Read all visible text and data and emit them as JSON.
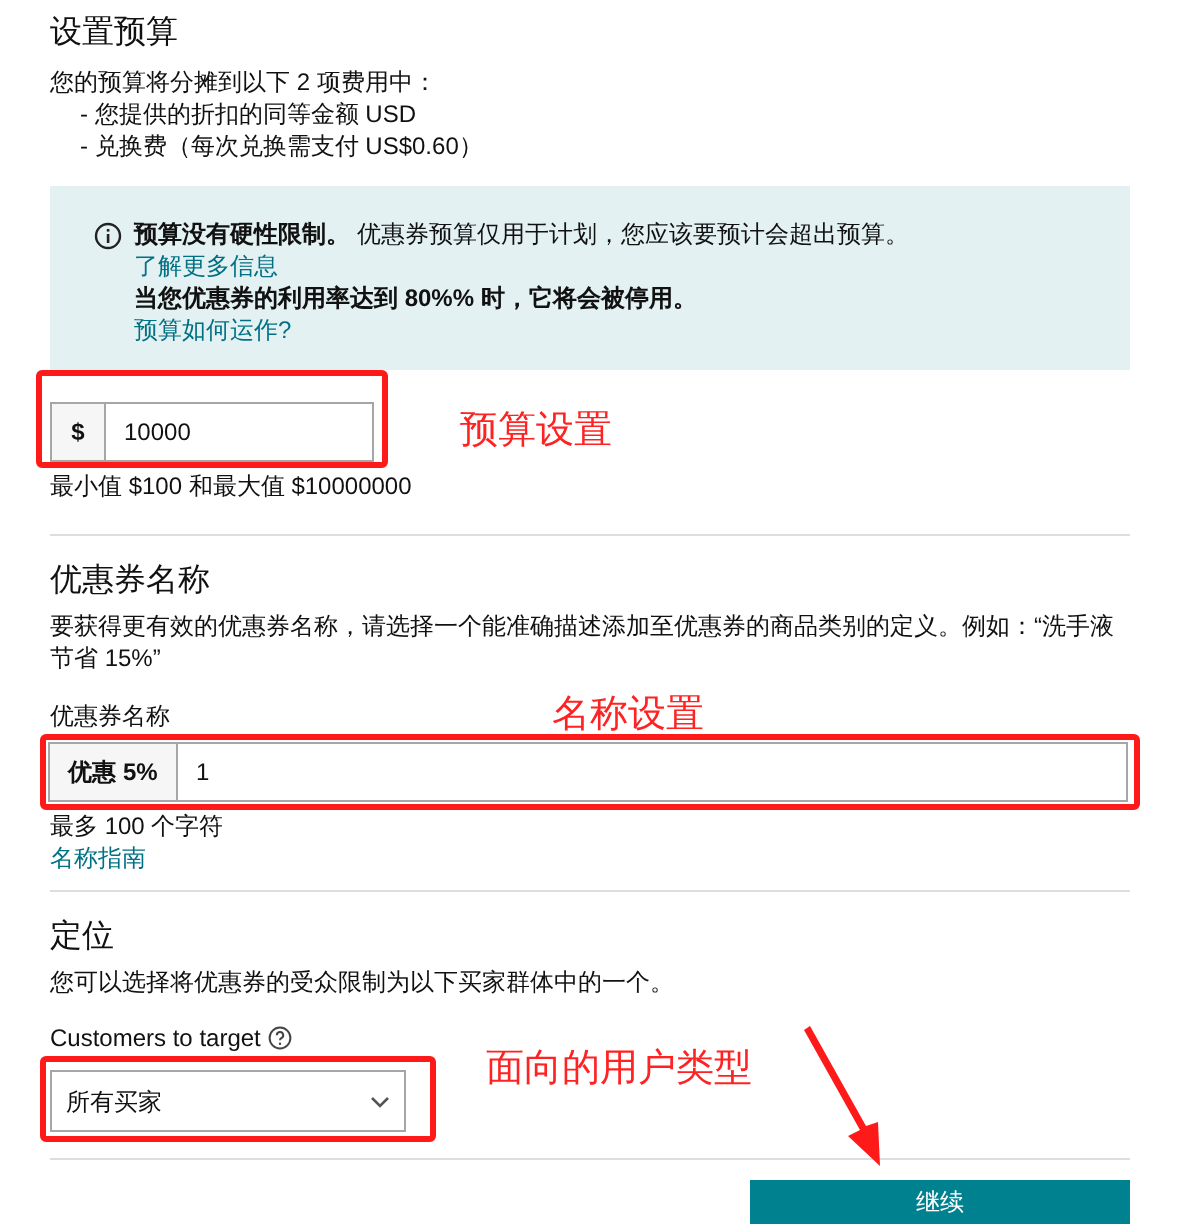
{
  "budget": {
    "title": "设置预算",
    "intro": "您的预算将分摊到以下 2 项费用中：",
    "items": [
      "- 您提供的折扣的同等金额 USD",
      "- 兑换费（每次兑换需支付 US$0.60）"
    ],
    "notice": {
      "bold": "预算没有硬性限制。",
      "text": "优惠券预算仅用于计划，您应该要预计会超出预算。",
      "link": "了解更多信息",
      "warning": "当您优惠券的利用率达到 80%% 时，它将会被停用。",
      "link2": "预算如何运作?"
    },
    "field": {
      "prefix": "$",
      "value": "10000"
    },
    "hint": "最小值 $100 和最大值 $10000000"
  },
  "name": {
    "title": "优惠券名称",
    "description": "要获得更有效的优惠券名称，请选择一个能准确描述添加至优惠券的商品类别的定义。例如：“洗手液节省 15%”",
    "label": "优惠券名称",
    "field": {
      "prefix": "优惠 5%",
      "value": "1"
    },
    "hint": "最多 100 个字符",
    "link": "名称指南"
  },
  "targeting": {
    "title": "定位",
    "description": "您可以选择将优惠券的受众限制为以下买家群体中的一个。",
    "label": "Customers to target",
    "select": {
      "value": "所有买家"
    }
  },
  "continue_button": "继续",
  "annotations": [
    {
      "text": "预算设置"
    },
    {
      "text": "名称设置"
    },
    {
      "text": "面向的用户类型"
    }
  ]
}
